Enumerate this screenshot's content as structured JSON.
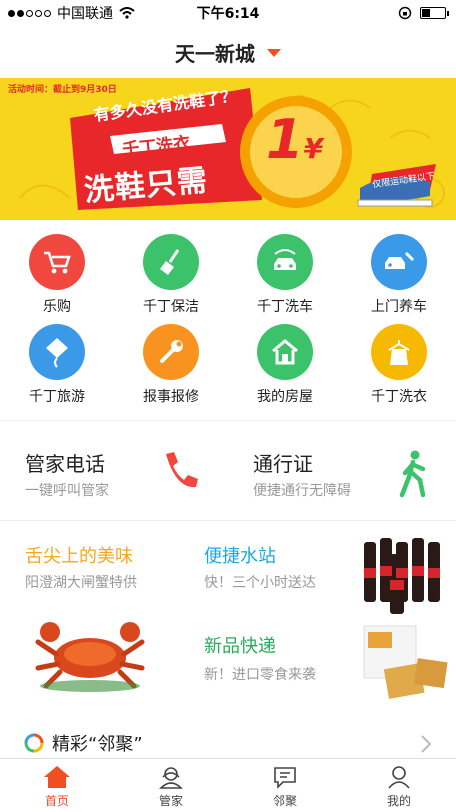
{
  "status_bar": {
    "carrier": "中国联通",
    "time": "下午6:14"
  },
  "nav": {
    "title": "天一新城"
  },
  "banner": {
    "date": "活动时间：截止到9月30日",
    "question": "有多久没有洗鞋了？",
    "brand": "千丁洗衣",
    "headline": "洗鞋只需",
    "price": "1",
    "currency": "¥",
    "tag": "仅限运动鞋以下",
    "colors": {
      "bg": "#f7d51d",
      "red": "#e8272a",
      "orange": "#f5a100"
    }
  },
  "grid": [
    {
      "label": "乐购",
      "icon": "cart-icon",
      "color": "#f0483e"
    },
    {
      "label": "千丁保洁",
      "icon": "broom-icon",
      "color": "#3cc26b"
    },
    {
      "label": "千丁洗车",
      "icon": "car-wash-icon",
      "color": "#3cc26b"
    },
    {
      "label": "上门养车",
      "icon": "car-repair-icon",
      "color": "#3b9ae8"
    },
    {
      "label": "千丁旅游",
      "icon": "kite-icon",
      "color": "#3b9ae8"
    },
    {
      "label": "报事报修",
      "icon": "wrench-icon",
      "color": "#f7931e"
    },
    {
      "label": "我的房屋",
      "icon": "house-icon",
      "color": "#3cc26b"
    },
    {
      "label": "千丁洗衣",
      "icon": "clothes-icon",
      "color": "#f7b900"
    }
  ],
  "services": {
    "phone": {
      "title": "管家电话",
      "subtitle": "一键呼叫管家",
      "icon": "phone-icon",
      "color": "#f0483e"
    },
    "pass": {
      "title": "通行证",
      "subtitle": "便捷通行无障碍",
      "icon": "walking-person-icon",
      "color": "#3cc26b"
    }
  },
  "promos": {
    "food": {
      "title": "舌尖上的美味",
      "subtitle": "阳澄湖大闸蟹特供",
      "color": "#f5a623"
    },
    "water": {
      "title": "便捷水站",
      "subtitle": "快！三个小时送达",
      "color": "#1ea7e0"
    },
    "snacks": {
      "title": "新品快递",
      "subtitle": "新！进口零食来袭",
      "color": "#2bab5a"
    }
  },
  "section": {
    "title": "精彩“邻聚”"
  },
  "tabs": [
    {
      "label": "首页",
      "icon": "home-icon",
      "active": true
    },
    {
      "label": "管家",
      "icon": "butler-icon",
      "active": false
    },
    {
      "label": "邻聚",
      "icon": "chat-icon",
      "active": false
    },
    {
      "label": "我的",
      "icon": "profile-icon",
      "active": false
    }
  ],
  "accent": "#f04e23"
}
